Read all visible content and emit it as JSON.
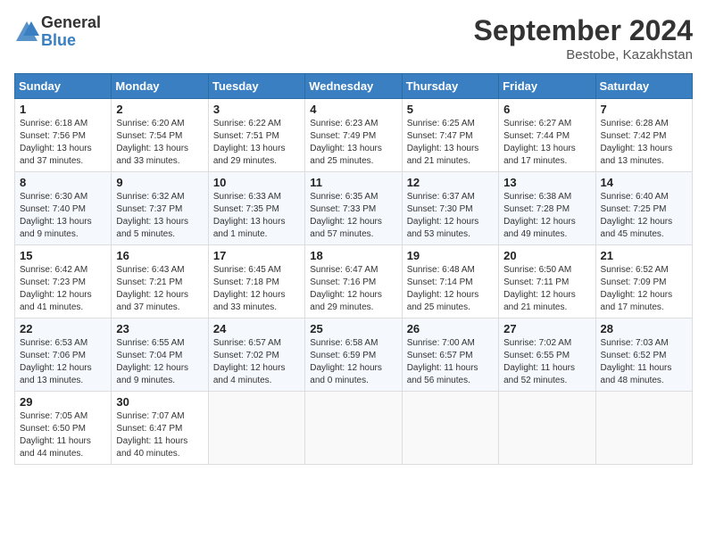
{
  "header": {
    "logo_general": "General",
    "logo_blue": "Blue",
    "month_title": "September 2024",
    "location": "Bestobe, Kazakhstan"
  },
  "weekdays": [
    "Sunday",
    "Monday",
    "Tuesday",
    "Wednesday",
    "Thursday",
    "Friday",
    "Saturday"
  ],
  "weeks": [
    [
      {
        "day": "1",
        "info": "Sunrise: 6:18 AM\nSunset: 7:56 PM\nDaylight: 13 hours\nand 37 minutes."
      },
      {
        "day": "2",
        "info": "Sunrise: 6:20 AM\nSunset: 7:54 PM\nDaylight: 13 hours\nand 33 minutes."
      },
      {
        "day": "3",
        "info": "Sunrise: 6:22 AM\nSunset: 7:51 PM\nDaylight: 13 hours\nand 29 minutes."
      },
      {
        "day": "4",
        "info": "Sunrise: 6:23 AM\nSunset: 7:49 PM\nDaylight: 13 hours\nand 25 minutes."
      },
      {
        "day": "5",
        "info": "Sunrise: 6:25 AM\nSunset: 7:47 PM\nDaylight: 13 hours\nand 21 minutes."
      },
      {
        "day": "6",
        "info": "Sunrise: 6:27 AM\nSunset: 7:44 PM\nDaylight: 13 hours\nand 17 minutes."
      },
      {
        "day": "7",
        "info": "Sunrise: 6:28 AM\nSunset: 7:42 PM\nDaylight: 13 hours\nand 13 minutes."
      }
    ],
    [
      {
        "day": "8",
        "info": "Sunrise: 6:30 AM\nSunset: 7:40 PM\nDaylight: 13 hours\nand 9 minutes."
      },
      {
        "day": "9",
        "info": "Sunrise: 6:32 AM\nSunset: 7:37 PM\nDaylight: 13 hours\nand 5 minutes."
      },
      {
        "day": "10",
        "info": "Sunrise: 6:33 AM\nSunset: 7:35 PM\nDaylight: 13 hours\nand 1 minute."
      },
      {
        "day": "11",
        "info": "Sunrise: 6:35 AM\nSunset: 7:33 PM\nDaylight: 12 hours\nand 57 minutes."
      },
      {
        "day": "12",
        "info": "Sunrise: 6:37 AM\nSunset: 7:30 PM\nDaylight: 12 hours\nand 53 minutes."
      },
      {
        "day": "13",
        "info": "Sunrise: 6:38 AM\nSunset: 7:28 PM\nDaylight: 12 hours\nand 49 minutes."
      },
      {
        "day": "14",
        "info": "Sunrise: 6:40 AM\nSunset: 7:25 PM\nDaylight: 12 hours\nand 45 minutes."
      }
    ],
    [
      {
        "day": "15",
        "info": "Sunrise: 6:42 AM\nSunset: 7:23 PM\nDaylight: 12 hours\nand 41 minutes."
      },
      {
        "day": "16",
        "info": "Sunrise: 6:43 AM\nSunset: 7:21 PM\nDaylight: 12 hours\nand 37 minutes."
      },
      {
        "day": "17",
        "info": "Sunrise: 6:45 AM\nSunset: 7:18 PM\nDaylight: 12 hours\nand 33 minutes."
      },
      {
        "day": "18",
        "info": "Sunrise: 6:47 AM\nSunset: 7:16 PM\nDaylight: 12 hours\nand 29 minutes."
      },
      {
        "day": "19",
        "info": "Sunrise: 6:48 AM\nSunset: 7:14 PM\nDaylight: 12 hours\nand 25 minutes."
      },
      {
        "day": "20",
        "info": "Sunrise: 6:50 AM\nSunset: 7:11 PM\nDaylight: 12 hours\nand 21 minutes."
      },
      {
        "day": "21",
        "info": "Sunrise: 6:52 AM\nSunset: 7:09 PM\nDaylight: 12 hours\nand 17 minutes."
      }
    ],
    [
      {
        "day": "22",
        "info": "Sunrise: 6:53 AM\nSunset: 7:06 PM\nDaylight: 12 hours\nand 13 minutes."
      },
      {
        "day": "23",
        "info": "Sunrise: 6:55 AM\nSunset: 7:04 PM\nDaylight: 12 hours\nand 9 minutes."
      },
      {
        "day": "24",
        "info": "Sunrise: 6:57 AM\nSunset: 7:02 PM\nDaylight: 12 hours\nand 4 minutes."
      },
      {
        "day": "25",
        "info": "Sunrise: 6:58 AM\nSunset: 6:59 PM\nDaylight: 12 hours\nand 0 minutes."
      },
      {
        "day": "26",
        "info": "Sunrise: 7:00 AM\nSunset: 6:57 PM\nDaylight: 11 hours\nand 56 minutes."
      },
      {
        "day": "27",
        "info": "Sunrise: 7:02 AM\nSunset: 6:55 PM\nDaylight: 11 hours\nand 52 minutes."
      },
      {
        "day": "28",
        "info": "Sunrise: 7:03 AM\nSunset: 6:52 PM\nDaylight: 11 hours\nand 48 minutes."
      }
    ],
    [
      {
        "day": "29",
        "info": "Sunrise: 7:05 AM\nSunset: 6:50 PM\nDaylight: 11 hours\nand 44 minutes."
      },
      {
        "day": "30",
        "info": "Sunrise: 7:07 AM\nSunset: 6:47 PM\nDaylight: 11 hours\nand 40 minutes."
      },
      {
        "day": "",
        "info": ""
      },
      {
        "day": "",
        "info": ""
      },
      {
        "day": "",
        "info": ""
      },
      {
        "day": "",
        "info": ""
      },
      {
        "day": "",
        "info": ""
      }
    ]
  ]
}
